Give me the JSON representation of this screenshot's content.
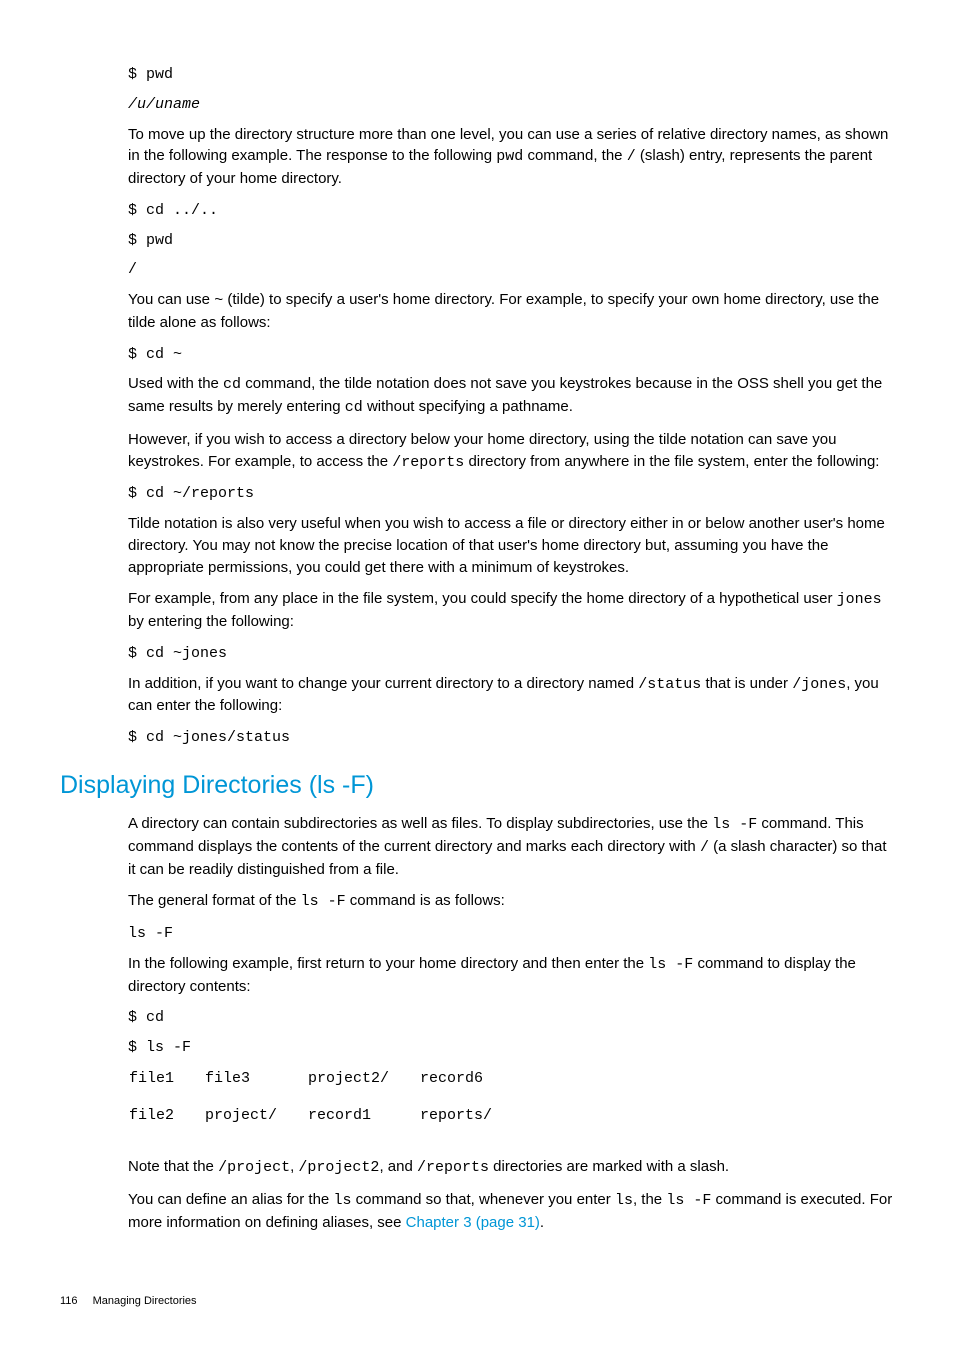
{
  "code1": "$ pwd",
  "code2": "/u/uname",
  "para1a": "To move up the directory structure more than one level, you can use a series of relative directory names, as shown in the following example. The response to the following ",
  "para1_cmd": "pwd",
  "para1b": " command, the ",
  "para1_slash": "/",
  "para1c": " (slash) entry, represents the parent directory of your home directory.",
  "code3": "$ cd ../..",
  "code4": "$ pwd",
  "code5": "/",
  "para2a": "You can use ",
  "para2_tilde": "~",
  "para2b": " (tilde) to specify a user's home directory. For example, to specify your own home directory, use the tilde alone as follows:",
  "code6": "$ cd ~",
  "para3a": "Used with the ",
  "para3_cd": "cd",
  "para3b": " command, the tilde notation does not save you keystrokes because in the OSS shell you get the same results by merely entering ",
  "para3_cd2": "cd",
  "para3c": " without specifying a pathname.",
  "para4a": "However, if you wish to access a directory below your home directory, using the tilde notation can save you keystrokes. For example, to access the ",
  "para4_reports": "/reports",
  "para4b": " directory from anywhere in the file system, enter the following:",
  "code7": "$ cd ~/reports",
  "para5": "Tilde notation is also very useful when you wish to access a file or directory either in or below another user's home directory. You may not know the precise location of that user's home directory but, assuming you have the appropriate permissions, you could get there with a minimum of keystrokes.",
  "para6a": "For example, from any place in the file system, you could specify the home directory of a hypothetical user ",
  "para6_jones": "jones",
  "para6b": " by entering the following:",
  "code8": "$ cd ~jones",
  "para7a": "In addition, if you want to change your current directory to a directory named ",
  "para7_status": "/status",
  "para7b": " that is under ",
  "para7_jones": "/jones",
  "para7c": ", you can enter the following:",
  "code9": "$ cd ~jones/status",
  "heading": "Displaying Directories (ls -F)",
  "para8a": "A directory can contain subdirectories as well as files. To display subdirectories, use the ",
  "para8_lsF": "ls -F",
  "para8b": " command. This command displays the contents of the current directory and marks each directory with ",
  "para8_slash": "/",
  "para8c": " (a slash character) so that it can be readily distinguished from a file.",
  "para9a": "The general format of the ",
  "para9_lsF": "ls -F",
  "para9b": " command is as follows:",
  "code10": "ls -F",
  "para10a": "In the following example, first return to your home directory and then enter the ",
  "para10_lsF": "ls -F",
  "para10b": " command to display the directory contents:",
  "code11": "$ cd",
  "code12": "$ ls -F",
  "t": {
    "r1c1": "file1",
    "r1c2": "file3",
    "r1c3": "project2/",
    "r1c4": "record6",
    "r2c1": "file2",
    "r2c2": "project/",
    "r2c3": "record1",
    "r2c4": "reports/"
  },
  "para11a": "Note that the ",
  "para11_p1": "/project",
  "para11b": ", ",
  "para11_p2": "/project2",
  "para11c": ", and ",
  "para11_p3": "/reports",
  "para11d": " directories are marked with a slash.",
  "para12a": "You can define an alias for the ",
  "para12_ls": "ls",
  "para12b": " command so that, whenever you enter ",
  "para12_ls2": "ls",
  "para12c": ", the ",
  "para12_lsF": "ls -F",
  "para12d": " command is executed. For more information on defining aliases, see ",
  "para12_link": "Chapter 3 (page 31)",
  "para12e": ".",
  "footer_page": "116",
  "footer_chapter": "Managing Directories"
}
